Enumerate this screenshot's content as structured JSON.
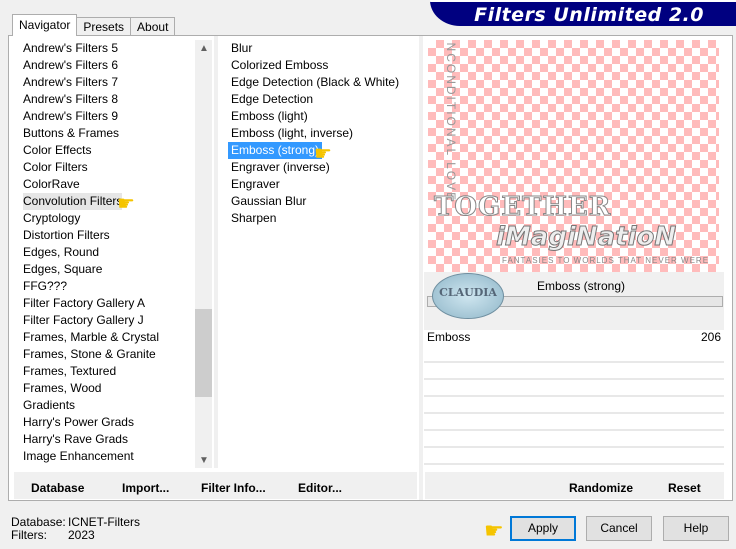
{
  "app": {
    "title": "Filters Unlimited 2.0"
  },
  "tabs": [
    {
      "label": "Navigator",
      "active": true
    },
    {
      "label": "Presets"
    },
    {
      "label": "About"
    }
  ],
  "categories": {
    "items": [
      "Andrew's Filters 5",
      "Andrew's Filters 6",
      "Andrew's Filters 7",
      "Andrew's Filters 8",
      "Andrew's Filters 9",
      "Buttons & Frames",
      "Color Effects",
      "Color Filters",
      "ColorRave",
      "Convolution Filters",
      "Cryptology",
      "Distortion Filters",
      "Edges, Round",
      "Edges, Square",
      "FFG???",
      "Filter Factory Gallery A",
      "Filter Factory Gallery J",
      "Frames, Marble & Crystal",
      "Frames, Stone & Granite",
      "Frames, Textured",
      "Frames, Wood",
      "Gradients",
      "Harry's Power Grads",
      "Harry's Rave Grads",
      "Image Enhancement"
    ],
    "selected": "Convolution Filters"
  },
  "filters": {
    "items": [
      "Blur",
      "Colorized Emboss",
      "Edge Detection (Black & White)",
      "Edge Detection",
      "Emboss (light)",
      "Emboss (light, inverse)",
      "Emboss (strong)",
      "Engraver (inverse)",
      "Engraver",
      "Gaussian Blur",
      "Sharpen"
    ],
    "selected": "Emboss (strong)"
  },
  "preview": {
    "text1": "TOGETHER",
    "text2": "iMagiNatioN",
    "text3": "FANTASIES TO WORLDS THAT NEVER WERE",
    "vertical": "UNCONDITIONAL LOVE",
    "logo": "CLAUDIA"
  },
  "control": {
    "filter_name": "Emboss (strong)",
    "param_name": "Emboss",
    "param_value": "206"
  },
  "bottom": {
    "database": "Database",
    "import": "Import...",
    "filter_info": "Filter Info...",
    "editor": "Editor...",
    "randomize": "Randomize",
    "reset": "Reset"
  },
  "status": {
    "database_label": "Database:",
    "database_value": "ICNET-Filters",
    "filters_label": "Filters:",
    "filters_value": "2023"
  },
  "buttons": {
    "apply": "Apply",
    "cancel": "Cancel",
    "help": "Help"
  },
  "colors": {
    "banner": "#000080",
    "selection": "#3399ff",
    "checker": "#ffbbbb"
  },
  "icons": {
    "pointer": "pointing-hand-icon"
  }
}
